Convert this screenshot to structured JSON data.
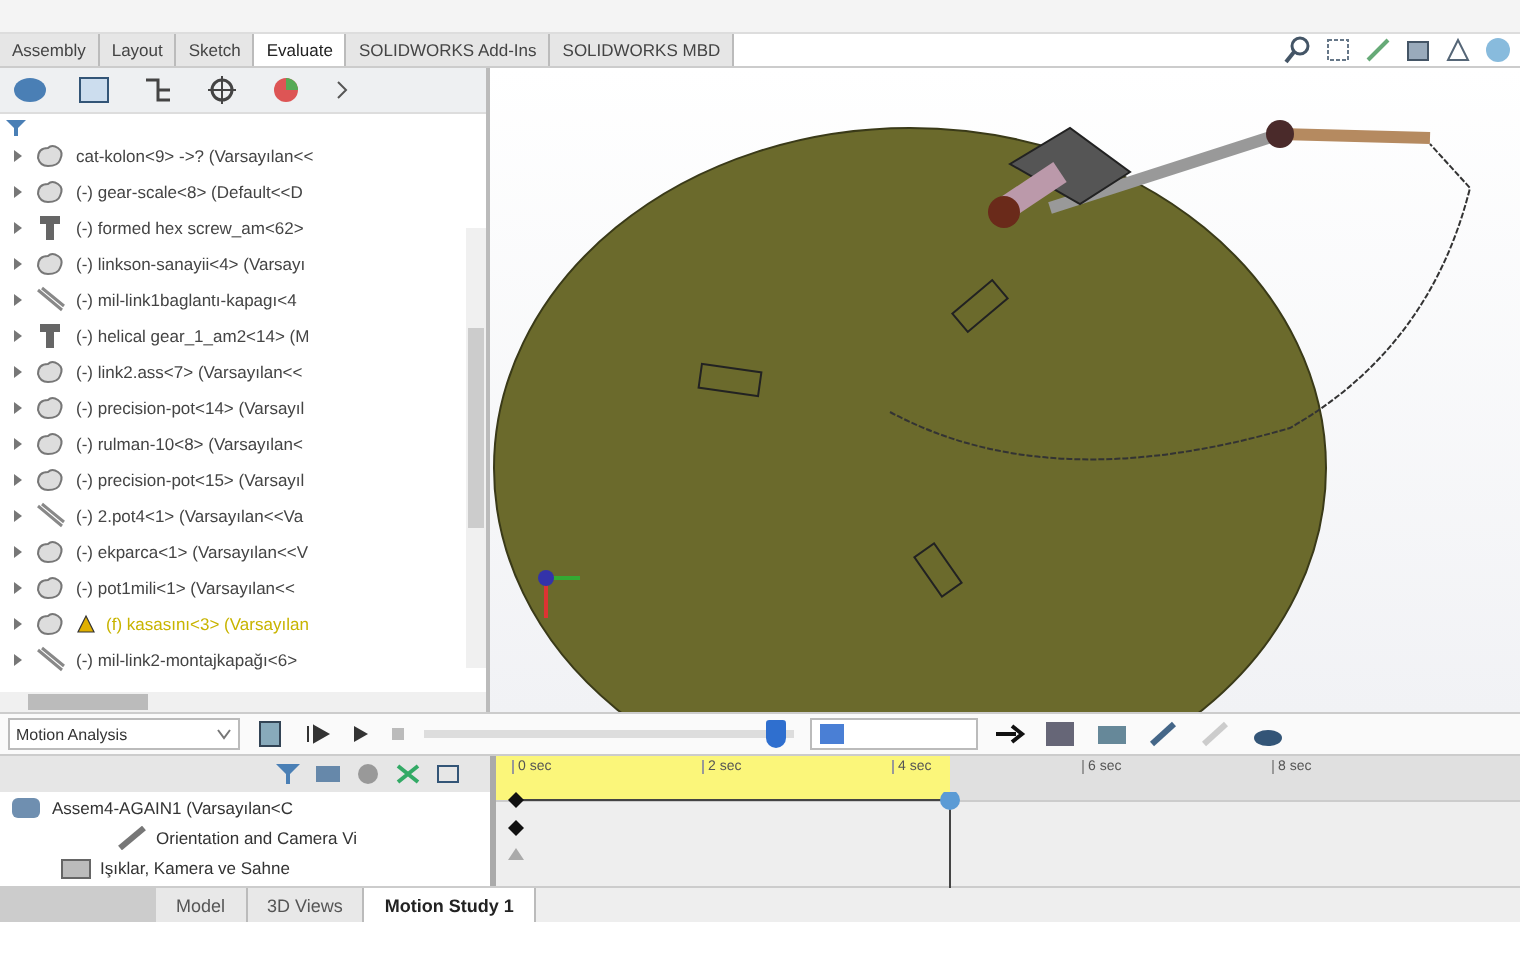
{
  "command_tabs": [
    {
      "label": "Assembly",
      "selected": false
    },
    {
      "label": "Layout",
      "selected": false
    },
    {
      "label": "Sketch",
      "selected": false
    },
    {
      "label": "Evaluate",
      "selected": true
    },
    {
      "label": "SOLIDWORKS Add-Ins",
      "selected": false
    },
    {
      "label": "SOLIDWORKS MBD",
      "selected": false
    }
  ],
  "feature_tree": {
    "items": [
      {
        "kind": "part",
        "label": "cat-kolon<9> ->? (Varsayılan<<"
      },
      {
        "kind": "part",
        "label": "(-) gear-scale<8> (Default<<D"
      },
      {
        "kind": "fastener",
        "label": "(-) formed hex screw_am<62>"
      },
      {
        "kind": "part",
        "label": "(-) linkson-sanayii<4> (Varsayı"
      },
      {
        "kind": "line",
        "label": "(-) mil-link1baglantı-kapagı<4"
      },
      {
        "kind": "fastener",
        "label": "(-) helical gear_1_am2<14> (M"
      },
      {
        "kind": "part",
        "label": "(-) link2.ass<7> (Varsayılan<<"
      },
      {
        "kind": "part",
        "label": "(-) precision-pot<14> (Varsayıl"
      },
      {
        "kind": "part",
        "label": "(-) rulman-10<8> (Varsayılan<"
      },
      {
        "kind": "part",
        "label": "(-) precision-pot<15> (Varsayıl"
      },
      {
        "kind": "line",
        "label": "(-) 2.pot4<1> (Varsayılan<<Va"
      },
      {
        "kind": "part",
        "label": "(-) ekparca<1> (Varsayılan<<V"
      },
      {
        "kind": "part",
        "label": "(-) pot1mili<1> (Varsayılan<<"
      },
      {
        "kind": "warning",
        "label": "(f) kasasını<3> (Varsayılan"
      },
      {
        "kind": "line",
        "label": "(-) mil-link2-montajkapağı<6>"
      }
    ]
  },
  "motion_toolbar": {
    "study_type": "Motion Analysis",
    "playback_slider": {
      "level": 0.95
    }
  },
  "timeline": {
    "rows": [
      {
        "kind": "assembly",
        "label": "Assem4-AGAIN1 (Varsayılan<C"
      },
      {
        "kind": "camera",
        "label": "Orientation and Camera Vi"
      },
      {
        "kind": "lights",
        "label": "Işıklar, Kamera ve Sahne"
      }
    ],
    "ticks": [
      "0 sec",
      "2 sec",
      "4 sec",
      "6 sec",
      "8 sec"
    ]
  },
  "bottom_tabs": [
    {
      "label": "Model",
      "selected": false
    },
    {
      "label": "3D Views",
      "selected": false
    },
    {
      "label": "Motion Study 1",
      "selected": true
    }
  ]
}
